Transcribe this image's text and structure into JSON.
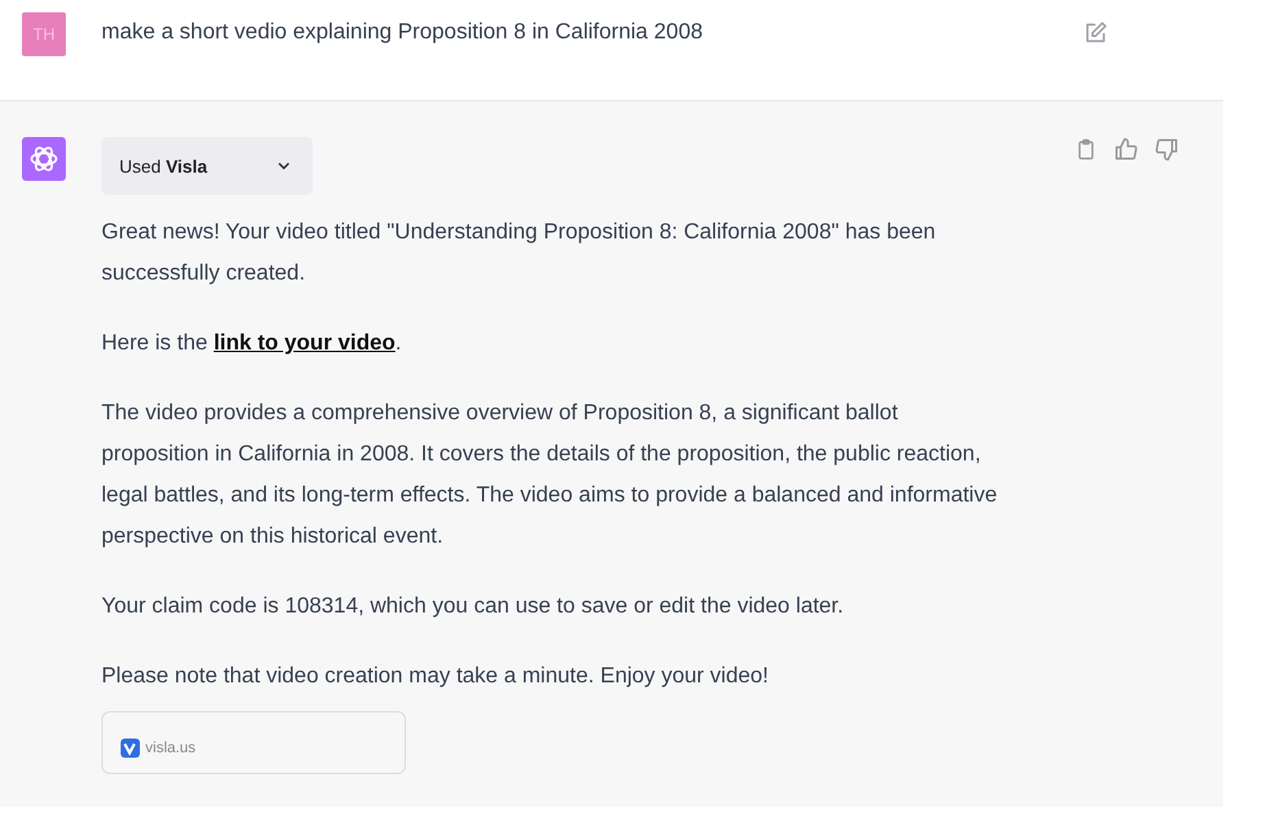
{
  "user_message": {
    "avatar": "TH",
    "text": "make a short vedio explaining Proposition 8 in California 2008"
  },
  "assistant_message": {
    "plugin_toggle": "Used **Visla**",
    "expanded": false,
    "paragraphs": [
      {
        "text": "Great news! Your video titled \"Understanding Proposition 8: California 2008\" has been successfully created."
      },
      {
        "text": "Here is the ",
        "link": "link to your video",
        "after": "."
      },
      {
        "text": "The video provides a comprehensive overview of Proposition 8, a significant ballot proposition in California in 2008. It covers the details of the proposition, the public reaction, legal battles, and its long-term effects. The video aims to provide a balanced and informative perspective on this historical event."
      },
      {
        "text": "Your claim code is 108314, which you can use to save or edit the video later."
      },
      {
        "text": "Please note that video creation may take a minute. Enjoy your video!"
      }
    ],
    "source_card": {
      "label": "visla.us"
    }
  }
}
